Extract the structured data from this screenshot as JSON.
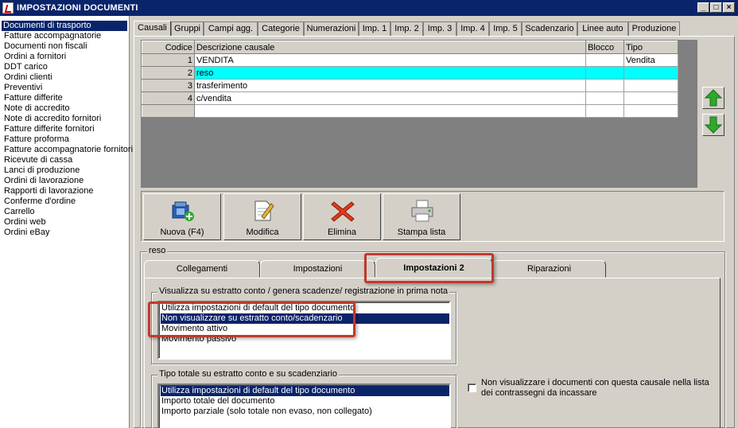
{
  "window": {
    "title": "IMPOSTAZIONI DOCUMENTI",
    "buttons": [
      "_",
      "□",
      "×"
    ]
  },
  "left_list": {
    "selected_index": 0,
    "items": [
      "Documenti di trasporto",
      "Fatture accompagnatorie",
      "Documenti non fiscali",
      "Ordini a fornitori",
      "DDT carico",
      "Ordini clienti",
      "Preventivi",
      "Fatture differite",
      "Note di accredito",
      "Note di accredito fornitori",
      "Fatture differite fornitori",
      "Fatture proforma",
      "Fatture accompagnatorie fornitori",
      "Ricevute di cassa",
      "Lanci di produzione",
      "Ordini di lavorazione",
      "Rapporti di lavorazione",
      "Conferme d'ordine",
      "Carrello",
      "Ordini web",
      "Ordini eBay"
    ]
  },
  "tabs": {
    "active_index": 0,
    "items": [
      "Causali",
      "Gruppi",
      "Campi agg.",
      "Categorie",
      "Numerazioni",
      "Imp. 1",
      "Imp. 2",
      "Imp. 3",
      "Imp. 4",
      "Imp. 5",
      "Scadenzario",
      "Linee auto",
      "Produzione"
    ]
  },
  "grid": {
    "headers": {
      "code": "Codice",
      "desc": "Descrizione causale",
      "block": "Blocco",
      "type": "Tipo"
    },
    "selected_index": 1,
    "rows": [
      {
        "code": "1",
        "desc": "VENDITA",
        "block": "",
        "type": "Vendita"
      },
      {
        "code": "2",
        "desc": "reso",
        "block": "",
        "type": ""
      },
      {
        "code": "3",
        "desc": "trasferimento",
        "block": "",
        "type": ""
      },
      {
        "code": "4",
        "desc": "c/vendita",
        "block": "",
        "type": ""
      },
      {
        "code": "",
        "desc": "",
        "block": "",
        "type": ""
      }
    ]
  },
  "side_buttons": {
    "up": "arrow-up-icon",
    "down": "arrow-down-icon",
    "color": "#2ea82e"
  },
  "toolbar": {
    "new_label": "Nuova (F4)",
    "edit_label": "Modifica",
    "delete_label": "Elimina",
    "print_label": "Stampa lista"
  },
  "detail": {
    "caption": "reso",
    "subtabs": [
      "Collegamenti",
      "Impostazioni",
      "Impostazioni 2",
      "Riparazioni"
    ],
    "active_subtab": 2,
    "group1": {
      "label": "Visualizza su estratto conto / genera scadenze/ registrazione  in prima nota",
      "selected_index": 1,
      "options": [
        "Utilizza impostazioni di default del tipo documento",
        "Non visualizzare su estratto conto/scadenzario",
        "Movimento attivo",
        "Movimento passivo"
      ]
    },
    "group2": {
      "label": "Tipo totale su estratto conto e su scadenziario",
      "selected_index": 0,
      "options": [
        "Utilizza impostazioni di default del tipo documento",
        "Importo totale del documento",
        "Importo parziale (solo totale non evaso, non collegato)"
      ]
    },
    "checkbox": {
      "label": "Non visualizzare i documenti con questa causale nella lista dei contrassegni da incassare",
      "checked": false
    }
  },
  "colors": {
    "selection": "#0a246a",
    "grid_highlight": "#00ffff",
    "annotation": "#c0392b"
  }
}
